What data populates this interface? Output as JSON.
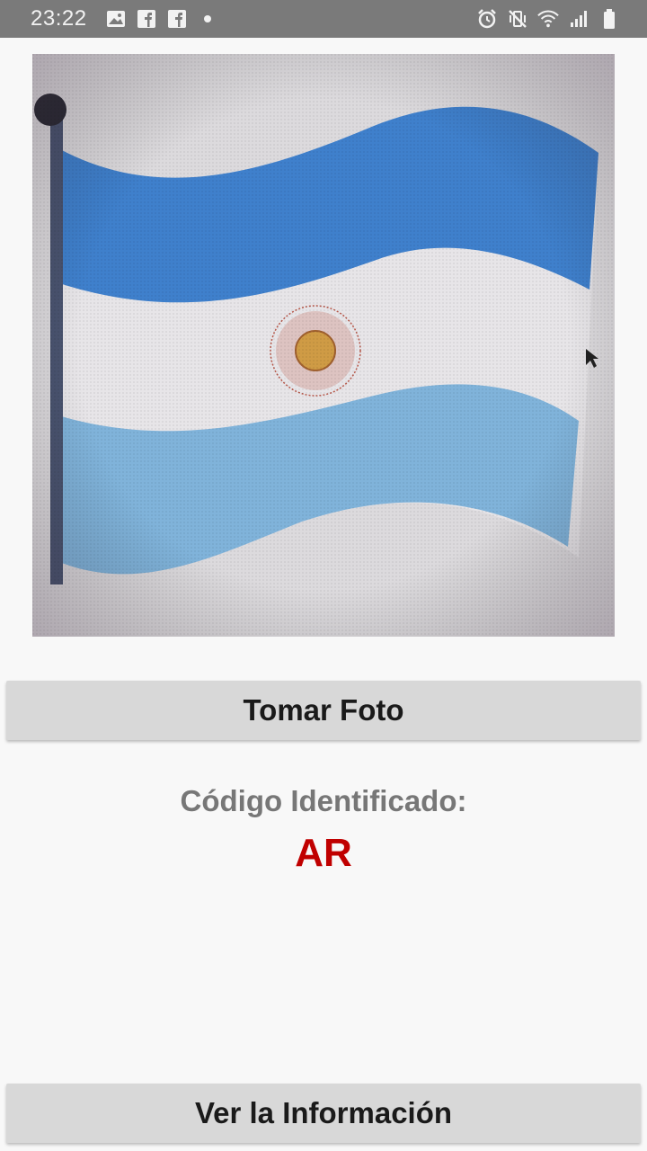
{
  "status_bar": {
    "time": "23:22",
    "left_icons": [
      "image-icon",
      "facebook-icon",
      "facebook-icon",
      "dot-icon"
    ],
    "right_icons": [
      "alarm-icon",
      "vibrate-mute-icon",
      "wifi-icon",
      "signal-icon",
      "battery-icon"
    ]
  },
  "photo": {
    "subject": "Argentina flag photo",
    "colors": {
      "sky_blue": "#3e82cf",
      "light_blue": "#7fb2d8",
      "white": "#e6e4e6",
      "sun": "#c9953f"
    }
  },
  "take_photo_button": {
    "label": "Tomar Foto"
  },
  "result": {
    "label": "Código Identificado:",
    "code": "AR",
    "code_color": "#c00000"
  },
  "info_button": {
    "label": "Ver la Información"
  }
}
